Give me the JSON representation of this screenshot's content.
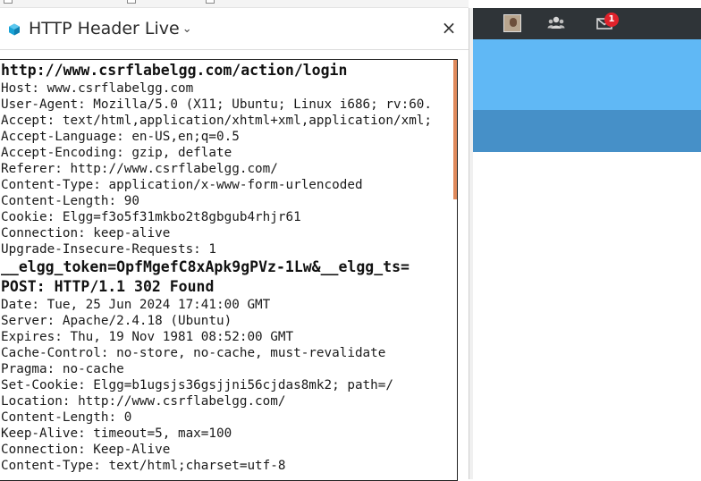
{
  "sidebar": {
    "title": "HTTP Header Live",
    "chevron": "⌄",
    "close": "×",
    "logo_icon": "cube-icon"
  },
  "request": {
    "url": "http://www.csrflabelgg.com/action/login",
    "headers": [
      "Host: www.csrflabelgg.com",
      "User-Agent: Mozilla/5.0 (X11; Ubuntu; Linux i686; rv:60.",
      "Accept: text/html,application/xhtml+xml,application/xml;",
      "Accept-Language: en-US,en;q=0.5",
      "Accept-Encoding: gzip, deflate",
      "Referer: http://www.csrflabelgg.com/",
      "Content-Type: application/x-www-form-urlencoded",
      "Content-Length: 90",
      "Cookie: Elgg=f3o5f31mkbo2t8gbgub4rhjr61",
      "Connection: keep-alive",
      "Upgrade-Insecure-Requests: 1"
    ],
    "body": "__elgg_token=OpfMgefC8xApk9gPVz-1Lw&__elgg_ts="
  },
  "response": {
    "status": "POST: HTTP/1.1 302 Found",
    "headers": [
      "Date: Tue, 25 Jun 2024 17:41:00 GMT",
      "Server: Apache/2.4.18 (Ubuntu)",
      "Expires: Thu, 19 Nov 1981 08:52:00 GMT",
      "Cache-Control: no-store, no-cache, must-revalidate",
      "Pragma: no-cache",
      "Set-Cookie: Elgg=b1ugsjs36gsjjni56cjdas8mk2; path=/",
      "Location: http://www.csrflabelgg.com/",
      "Content-Length: 0",
      "Keep-Alive: timeout=5, max=100",
      "Connection: Keep-Alive",
      "Content-Type: text/html;charset=utf-8"
    ]
  },
  "webpage": {
    "topbar_color": "#2f3438",
    "banner_color": "#60b8f5",
    "nav_color": "#4690c8",
    "avatar_icon": "user-avatar-icon",
    "friends_icon": "users-icon",
    "messages_icon": "envelope-icon",
    "messages_badge": "1"
  },
  "colors": {
    "accent_scroll": "#e08a5c",
    "badge": "#e0222b"
  }
}
